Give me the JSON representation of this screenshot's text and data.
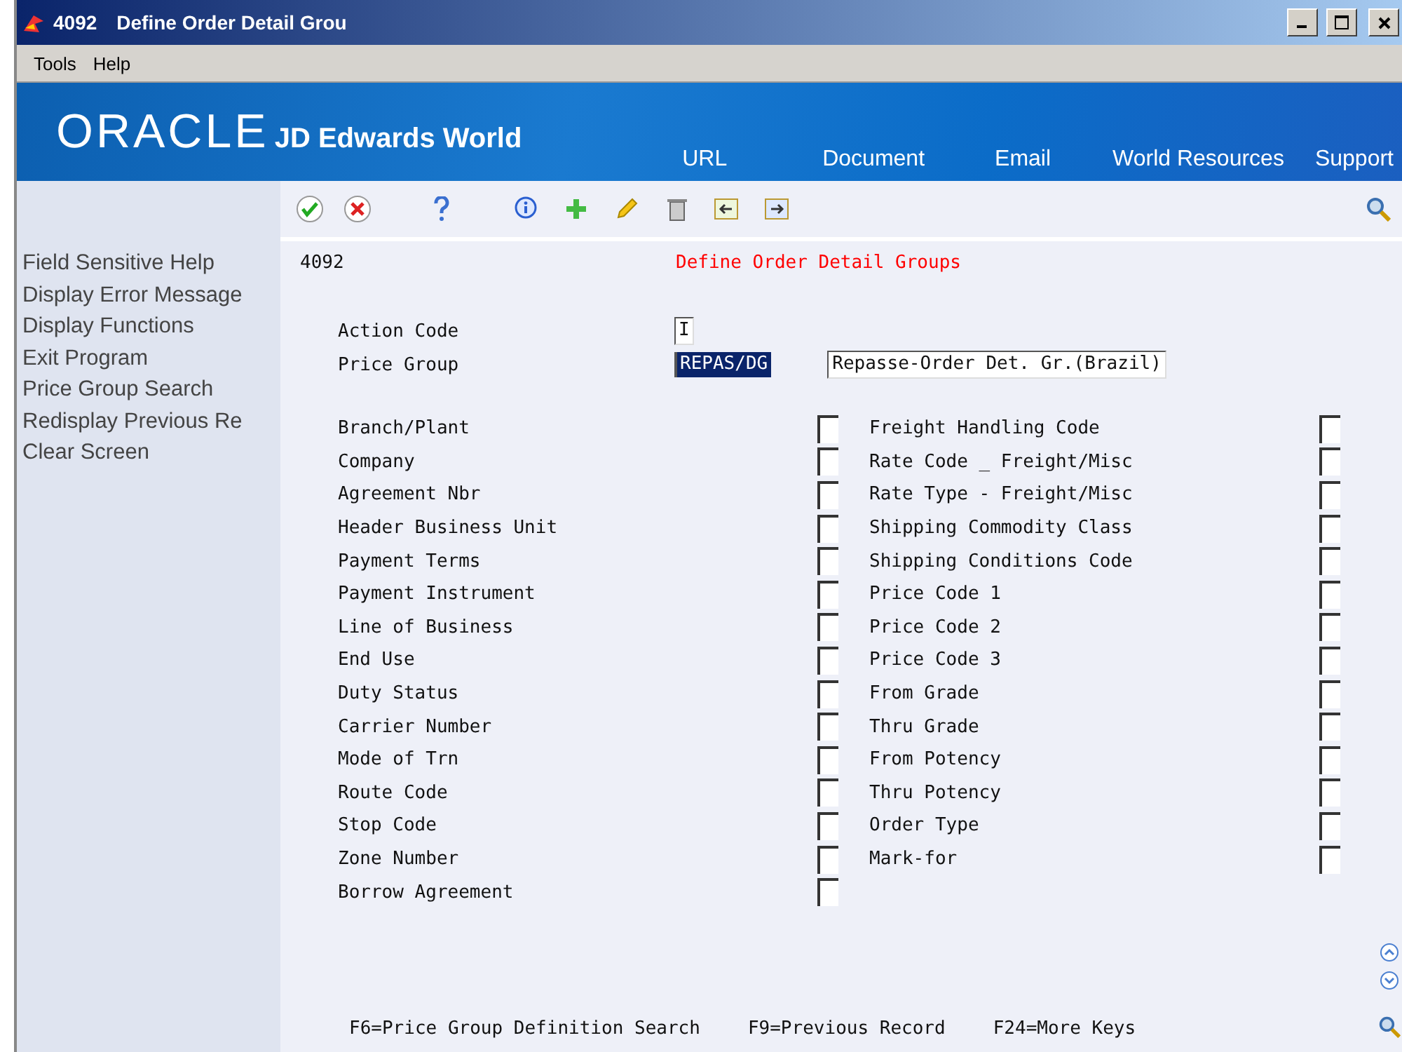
{
  "window": {
    "title_number": "4092",
    "title": "Define Order Detail Grou"
  },
  "menu": [
    "Tools",
    "Help"
  ],
  "banner": {
    "logo": "ORACLE",
    "product": "JD Edwards World",
    "links": [
      "URL",
      "Document",
      "Email",
      "World Resources",
      "Support"
    ]
  },
  "sidebar": {
    "items": [
      "Field Sensitive Help",
      "Display Error Message",
      "Display Functions",
      "Exit Program",
      "Price Group Search",
      "Redisplay Previous Re",
      "Clear Screen"
    ]
  },
  "form": {
    "program": "4092",
    "title": "Define Order Detail Groups",
    "action_code": {
      "label": "Action Code",
      "value": "I"
    },
    "price_group": {
      "label": "Price Group",
      "value": "REPAS/DG",
      "description": "Repasse-Order Det. Gr.(Brazil)"
    },
    "left_fields": [
      "Branch/Plant",
      "Company",
      "Agreement Nbr",
      "Header Business Unit",
      "Payment Terms",
      "Payment Instrument",
      "Line of Business",
      "End Use",
      "Duty Status",
      "Carrier Number",
      "Mode of Trn",
      "Route Code",
      "Stop Code",
      "Zone Number",
      "Borrow Agreement"
    ],
    "right_fields": [
      "Freight Handling Code",
      "Rate Code _ Freight/Misc",
      "Rate Type - Freight/Misc",
      "Shipping Commodity Class",
      "Shipping Conditions Code",
      "Price Code 1",
      "Price Code 2",
      "Price Code 3",
      "From Grade",
      "Thru Grade",
      "From Potency",
      "Thru Potency",
      "Order Type",
      "Mark-for"
    ]
  },
  "function_keys": [
    "F6=Price Group Definition Search",
    "F9=Previous Record",
    "F24=More Keys"
  ]
}
